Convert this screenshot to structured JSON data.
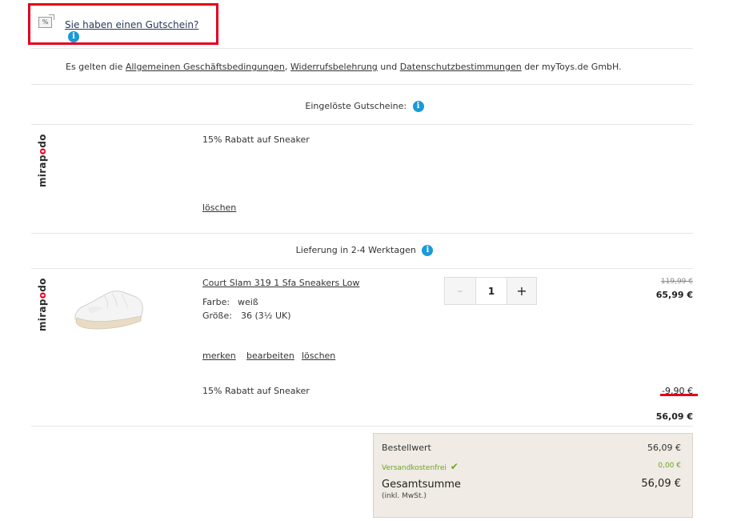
{
  "voucher": {
    "icon_text": "%",
    "link_label": "Sie haben einen Gutschein?"
  },
  "terms": {
    "prefix": "Es gelten die ",
    "link1": "Allgemeinen Geschäftsbedingungen",
    "sep1": ", ",
    "link2": "Widerrufsbelehrung",
    "sep2": " und ",
    "link3": "Datenschutzbestimmungen",
    "suffix": " der myToys.de GmbH."
  },
  "redeemed": {
    "heading": "Eingelöste Gutscheine:",
    "brand": "mirapodo",
    "description": "15% Rabatt auf Sneaker",
    "delete_label": "löschen"
  },
  "delivery": {
    "heading": "Lieferung in 2-4 Werktagen"
  },
  "item": {
    "brand": "mirapodo",
    "name": "Court Slam 319 1 Sfa Sneakers Low",
    "color_label": "Farbe:",
    "color_value": "weiß",
    "size_label": "Größe:",
    "size_value": "36 (3½ UK)",
    "actions": {
      "save": "merken",
      "edit": "bearbeiten",
      "delete": "löschen"
    },
    "quantity": "1",
    "qty_minus": "–",
    "qty_plus": "+",
    "old_price": "119,99 €",
    "price": "65,99 €",
    "discount_label": "15% Rabatt auf Sneaker",
    "discount_value": "-9,90 €",
    "subtotal": "56,09 €"
  },
  "summary": {
    "order_value_label": "Bestellwert",
    "order_value": "56,09 €",
    "shipping_label": "Versandkostenfrei",
    "shipping_value": "0,00 €",
    "total_label": "Gesamtsumme",
    "total_value": "56,09 €",
    "tax_note": "(inkl. MwSt.)"
  },
  "colors": {
    "highlight_red": "#e3001b",
    "info_blue": "#1a9ad6",
    "shipping_green": "#6aa527",
    "summary_bg": "#f0ebe4"
  }
}
